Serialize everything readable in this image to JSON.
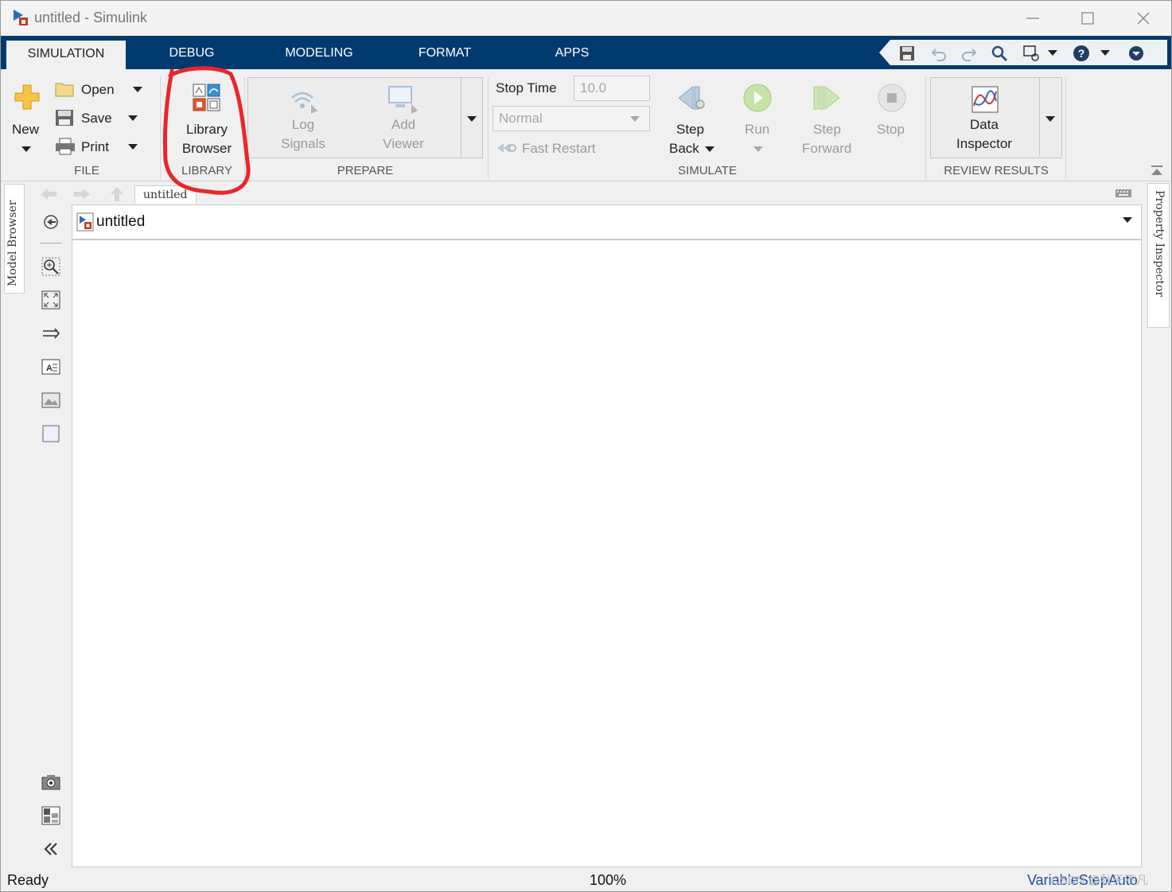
{
  "window": {
    "title": "untitled - Simulink"
  },
  "tabs": [
    {
      "label": "SIMULATION",
      "active": true
    },
    {
      "label": "DEBUG"
    },
    {
      "label": "MODELING"
    },
    {
      "label": "FORMAT"
    },
    {
      "label": "APPS"
    }
  ],
  "quick_access": [
    "save-icon",
    "undo-icon",
    "redo-icon",
    "search-icon",
    "find-model-icon",
    "help-icon",
    "expand-icon"
  ],
  "ribbon": {
    "file": {
      "new_label": "New",
      "open_label": "Open",
      "save_label": "Save",
      "print_label": "Print",
      "section_label": "FILE"
    },
    "library": {
      "line1": "Library",
      "line2": "Browser",
      "section_label": "LIBRARY"
    },
    "prepare": {
      "log_line1": "Log",
      "log_line2": "Signals",
      "add_line1": "Add",
      "add_line2": "Viewer",
      "section_label": "PREPARE"
    },
    "simulate": {
      "stop_time_label": "Stop Time",
      "stop_time_value": "10.0",
      "mode_value": "Normal",
      "fast_restart_label": "Fast Restart",
      "step_back_line1": "Step",
      "step_back_line2": "Back",
      "run_label": "Run",
      "step_fwd_line1": "Step",
      "step_fwd_line2": "Forward",
      "stop_label": "Stop",
      "section_label": "SIMULATE"
    },
    "review": {
      "line1": "Data",
      "line2": "Inspector",
      "section_label": "REVIEW RESULTS"
    }
  },
  "side_tabs": {
    "left": "Model Browser",
    "right": "Property Inspector"
  },
  "explorer": {
    "breadcrumb": "untitled",
    "model_name": "untitled"
  },
  "status": {
    "left": "Ready",
    "zoom": "100%",
    "solver": "VariableStepAuto",
    "watermark": "CSDN @秋天不凡"
  },
  "colors": {
    "tab_bar": "#003a6f",
    "annotation": "#e8262c",
    "solver_text": "#1a4c9e"
  }
}
